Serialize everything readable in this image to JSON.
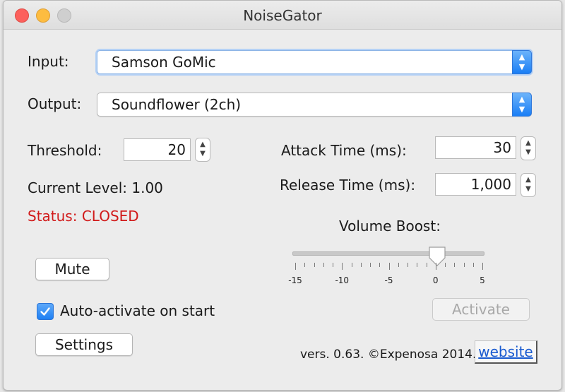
{
  "window": {
    "title": "NoiseGator"
  },
  "input": {
    "label": "Input:",
    "value": "Samson GoMic"
  },
  "output": {
    "label": "Output:",
    "value": "Soundflower (2ch)"
  },
  "threshold": {
    "label": "Threshold:",
    "value": "20"
  },
  "attack": {
    "label": "Attack Time (ms):",
    "value": "30"
  },
  "release": {
    "label": "Release Time (ms):",
    "value": "1,000"
  },
  "level": {
    "label": "Current Level: 1.00"
  },
  "status": {
    "text": "Status: CLOSED",
    "color": "#d11a1a"
  },
  "volume_boost": {
    "label": "Volume Boost:",
    "value": 0,
    "min": -15,
    "max": 5,
    "tick_labels": [
      "-15",
      "-10",
      "-5",
      "0",
      "5"
    ]
  },
  "buttons": {
    "mute": "Mute",
    "settings": "Settings",
    "activate": "Activate",
    "website": "website"
  },
  "auto_activate": {
    "label": "Auto-activate on start",
    "checked": true
  },
  "version": "vers. 0.63. ©Expenosa 2014.",
  "icons": {
    "combo_arrow": "up-down-chevron-icon",
    "stepper": "stepper-arrows-icon",
    "check": "checkmark-icon"
  },
  "colors": {
    "accent": "#1a7ef5",
    "status": "#d11a1a",
    "link": "#1a5bd0"
  }
}
